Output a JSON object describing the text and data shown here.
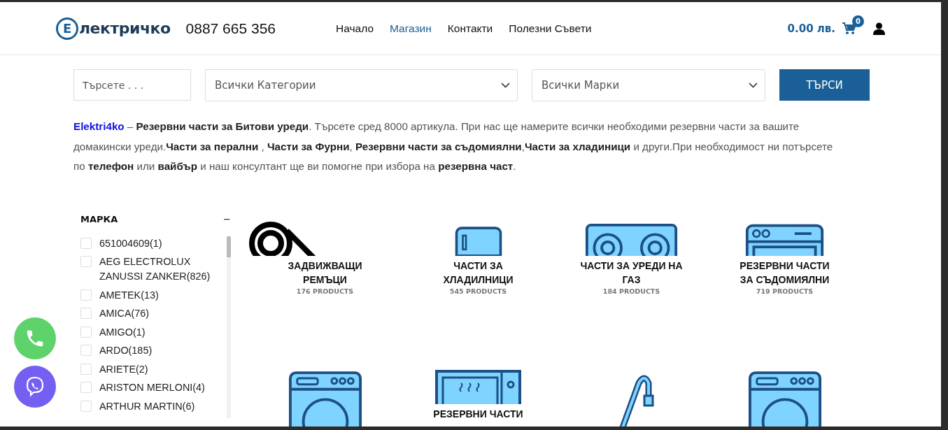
{
  "header": {
    "logo_letter": "Е",
    "logo_text": "лектричко",
    "phone": "0887 665 356",
    "nav": [
      {
        "label": "Начало",
        "selected": false
      },
      {
        "label": "Магазин",
        "selected": true
      },
      {
        "label": "Контакти",
        "selected": false
      },
      {
        "label": "Полезни Съвети",
        "selected": false
      }
    ],
    "cart_total": "0.00 лв.",
    "cart_count": "0"
  },
  "search": {
    "placeholder": "Търсете . . .",
    "category_select": "Всички Категории",
    "brand_select": "Всички Марки",
    "button": "ТЪРСИ"
  },
  "intro": {
    "link": "Elektri4ko",
    "text": " – **Резервни части за Битови уреди**. Търсете сред 8000 артикула. При нас ще намерите всички необходими резервни части за вашите домакински уреди.**Части за перални** , **Части за Фурни**, **Резервни части за съдомиялни**,**Части за хладиници** и други.При необходимост ни потърсете по **телефон** или **вайбър** и наш консултант ще ви помогне при избора на **резервна част**."
  },
  "filter": {
    "title": "МАРКА",
    "toggle": "−",
    "items": [
      {
        "name": "651004609",
        "count": "(1)",
        "checked": false
      },
      {
        "name": "AEG ELECTROLUX ZANUSSI ZANKER",
        "count": "(826)",
        "checked": false
      },
      {
        "name": "AMETEK",
        "count": "(13)",
        "checked": false
      },
      {
        "name": "AMICA",
        "count": "(76)",
        "checked": false
      },
      {
        "name": "AMIGO",
        "count": "(1)",
        "checked": false
      },
      {
        "name": "ARDO",
        "count": "(185)",
        "checked": false
      },
      {
        "name": "ARIETE",
        "count": "(2)",
        "checked": false
      },
      {
        "name": "ARISTON MERLONI",
        "count": "(4)",
        "checked": false
      },
      {
        "name": "ARTHUR MARTIN",
        "count": "(6)",
        "checked": false
      }
    ]
  },
  "categories": [
    {
      "kind": "belt",
      "title": "ЗАДВИЖВАЩИ РЕМЪЦИ",
      "count": "176 PRODUCTS"
    },
    {
      "kind": "fridge",
      "title": "ЧАСТИ ЗА ХЛАДИЛНИЦИ",
      "count": "545 PRODUCTS"
    },
    {
      "kind": "stove",
      "title": "ЧАСТИ ЗА УРЕДИ НА ГАЗ",
      "count": "184 PRODUCTS"
    },
    {
      "kind": "dishwasher",
      "title": "РЕЗЕРВНИ ЧАСТИ ЗА СЪДОМИЯЛНИ",
      "count": "719 PRODUCTS"
    },
    {
      "kind": "washer"
    },
    {
      "kind": "microwave",
      "title": "РЕЗЕРВНИ ЧАСТИ"
    },
    {
      "kind": "faucet"
    },
    {
      "kind": "washer"
    }
  ]
}
